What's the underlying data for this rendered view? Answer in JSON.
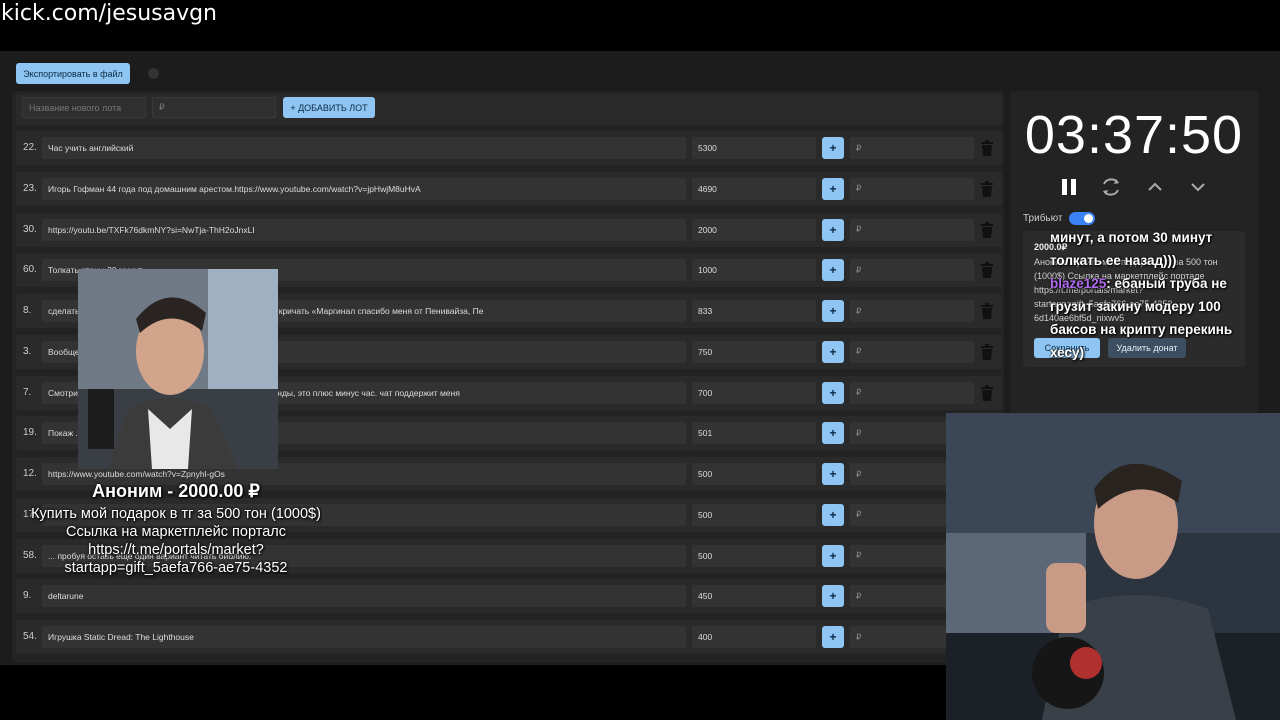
{
  "stream": {
    "channel_url": "kick.com/jesusavgn"
  },
  "toolbar": {
    "export_label": "Экспортировать в файл"
  },
  "new_lot": {
    "name_placeholder": "Название нового лота",
    "price_placeholder": "₽",
    "add_label": "+ ДОБАВИТЬ ЛОТ"
  },
  "lots": [
    {
      "num": "22.",
      "name": "Час учить английский",
      "amount": "5300"
    },
    {
      "num": "23.",
      "name": "Игорь Гофман 44 года под домашним арестом.https://www.youtube.com/watch?v=jpHwjM8uHvA",
      "amount": "4690"
    },
    {
      "num": "30.",
      "name": "https://youtu.be/TXFk76dkmNY?si=NwTja-ThH2oJnxLI",
      "amount": "2000"
    },
    {
      "num": "60.",
      "name": "Толкать стены 30 минут",
      "amount": "1000"
    },
    {
      "num": "8.",
      "name": "сделать ... Пенивайза. и 60 минут прятаться за креслом и кричать «Маргинал спасибо меня от Пенивайза, Пе",
      "amount": "833"
    },
    {
      "num": "3.",
      "name": "Вообще ...",
      "amount": "750"
    },
    {
      "num": "7.",
      "name": "Смотри ... the curse of blackwater, не перематывая ни секунды, это плюс минус час. чат поддержит меня",
      "amount": "700"
    },
    {
      "num": "19.",
      "name": "Покаж ...",
      "amount": "501"
    },
    {
      "num": "12.",
      "name": "https://www.youtube.com/watch?v=Zpnyhl-gOs",
      "amount": "500"
    },
    {
      "num": "17.",
      "name": "...",
      "amount": "500"
    },
    {
      "num": "58.",
      "name": "... пробуя оставь еще один вариант читать библию.",
      "amount": "500"
    },
    {
      "num": "9.",
      "name": "deltarune",
      "amount": "450"
    },
    {
      "num": "54.",
      "name": "Игрушка Static Dread: The Lighthouse",
      "amount": "400"
    }
  ],
  "ruble_placeholder": "₽",
  "timer": {
    "value": "03:37:50"
  },
  "tribute": {
    "label": "Трибьют",
    "enabled": true
  },
  "donation": {
    "amount": "2000.0₽",
    "text": "Аноним: Купить мой подарок в тг за 500 тон (1000$) Ссылка на маркетплейс портале https://t.me/portals/market? startapp=gift_5aefa766-ae75-4352-6d140ae6bf5d_nixwv5",
    "accept_label": "Сохранить",
    "delete_label": "Удалить донат"
  },
  "chat_overlay": {
    "line1": "минут, а потом 30 минут толкать ее назад)))",
    "user": "blaze125",
    "message": ": ебаный труба не грузит закину модеру 100 баксов на крипту перекинь хесу)"
  },
  "alert": {
    "title": "Аноним - 2000.00 ₽",
    "message_1": "Купить мой подарок в тг за 500 тон (1000$)",
    "message_2": "Ссылка на маркетплейс порталс https://t.me/portals/market? startapp=gift_5aefa766-ae75-4352"
  },
  "colors": {
    "accent": "#8ec5f2",
    "panel": "#232323",
    "toggle": "#3b82f6",
    "username": "#b06cf0"
  }
}
